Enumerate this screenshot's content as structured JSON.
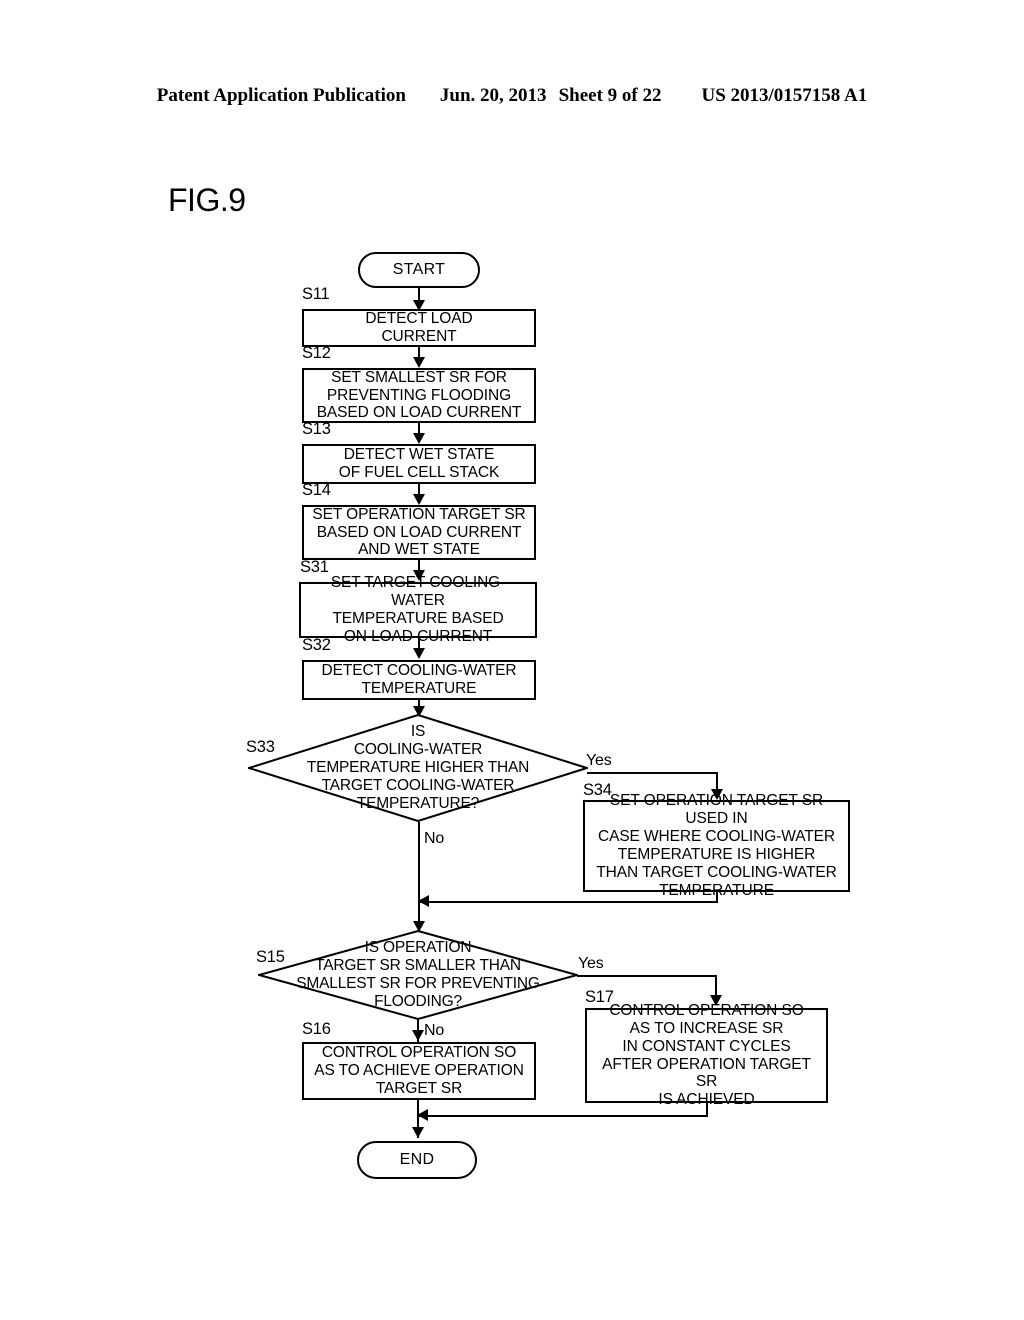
{
  "header": {
    "publication": "Patent Application Publication",
    "date": "Jun. 20, 2013",
    "sheet": "Sheet 9 of 22",
    "patent_number": "US 2013/0157158 A1"
  },
  "figure": {
    "label": "FIG.9"
  },
  "flowchart": {
    "start": {
      "text": "START"
    },
    "end": {
      "text": "END"
    },
    "steps": [
      {
        "id": "S11",
        "text": "DETECT LOAD\nCURRENT"
      },
      {
        "id": "S12",
        "text": "SET SMALLEST SR FOR\nPREVENTING FLOODING\nBASED ON LOAD CURRENT"
      },
      {
        "id": "S13",
        "text": "DETECT WET STATE\nOF FUEL CELL STACK"
      },
      {
        "id": "S14",
        "text": "SET OPERATION TARGET SR\nBASED ON LOAD CURRENT\nAND WET STATE"
      },
      {
        "id": "S31",
        "text": "SET TARGET COOLING-WATER\nTEMPERATURE BASED\nON LOAD CURRENT"
      },
      {
        "id": "S32",
        "text": "DETECT COOLING-WATER\nTEMPERATURE"
      },
      {
        "id": "S33",
        "text": "IS\nCOOLING-WATER\nTEMPERATURE HIGHER THAN\nTARGET COOLING-WATER\nTEMPERATURE?",
        "type": "decision"
      },
      {
        "id": "S34",
        "text": "SET OPERATION TARGET SR USED IN\nCASE WHERE COOLING-WATER\nTEMPERATURE IS HIGHER\nTHAN TARGET COOLING-WATER\nTEMPERATURE"
      },
      {
        "id": "S15",
        "text": "IS OPERATION\nTARGET SR SMALLER THAN\nSMALLEST SR FOR PREVENTING\nFLOODING?",
        "type": "decision"
      },
      {
        "id": "S16",
        "text": "CONTROL OPERATION SO\nAS TO ACHIEVE OPERATION\nTARGET SR"
      },
      {
        "id": "S17",
        "text": "CONTROL OPERATION SO\nAS TO INCREASE SR\nIN CONSTANT CYCLES\nAFTER OPERATION TARGET SR\nIS ACHIEVED"
      }
    ],
    "branch_labels": {
      "s33_yes": "Yes",
      "s33_no": "No",
      "s15_yes": "Yes",
      "s15_no": "No"
    },
    "colors": {
      "stroke": "#000000",
      "fill": "#ffffff"
    }
  }
}
